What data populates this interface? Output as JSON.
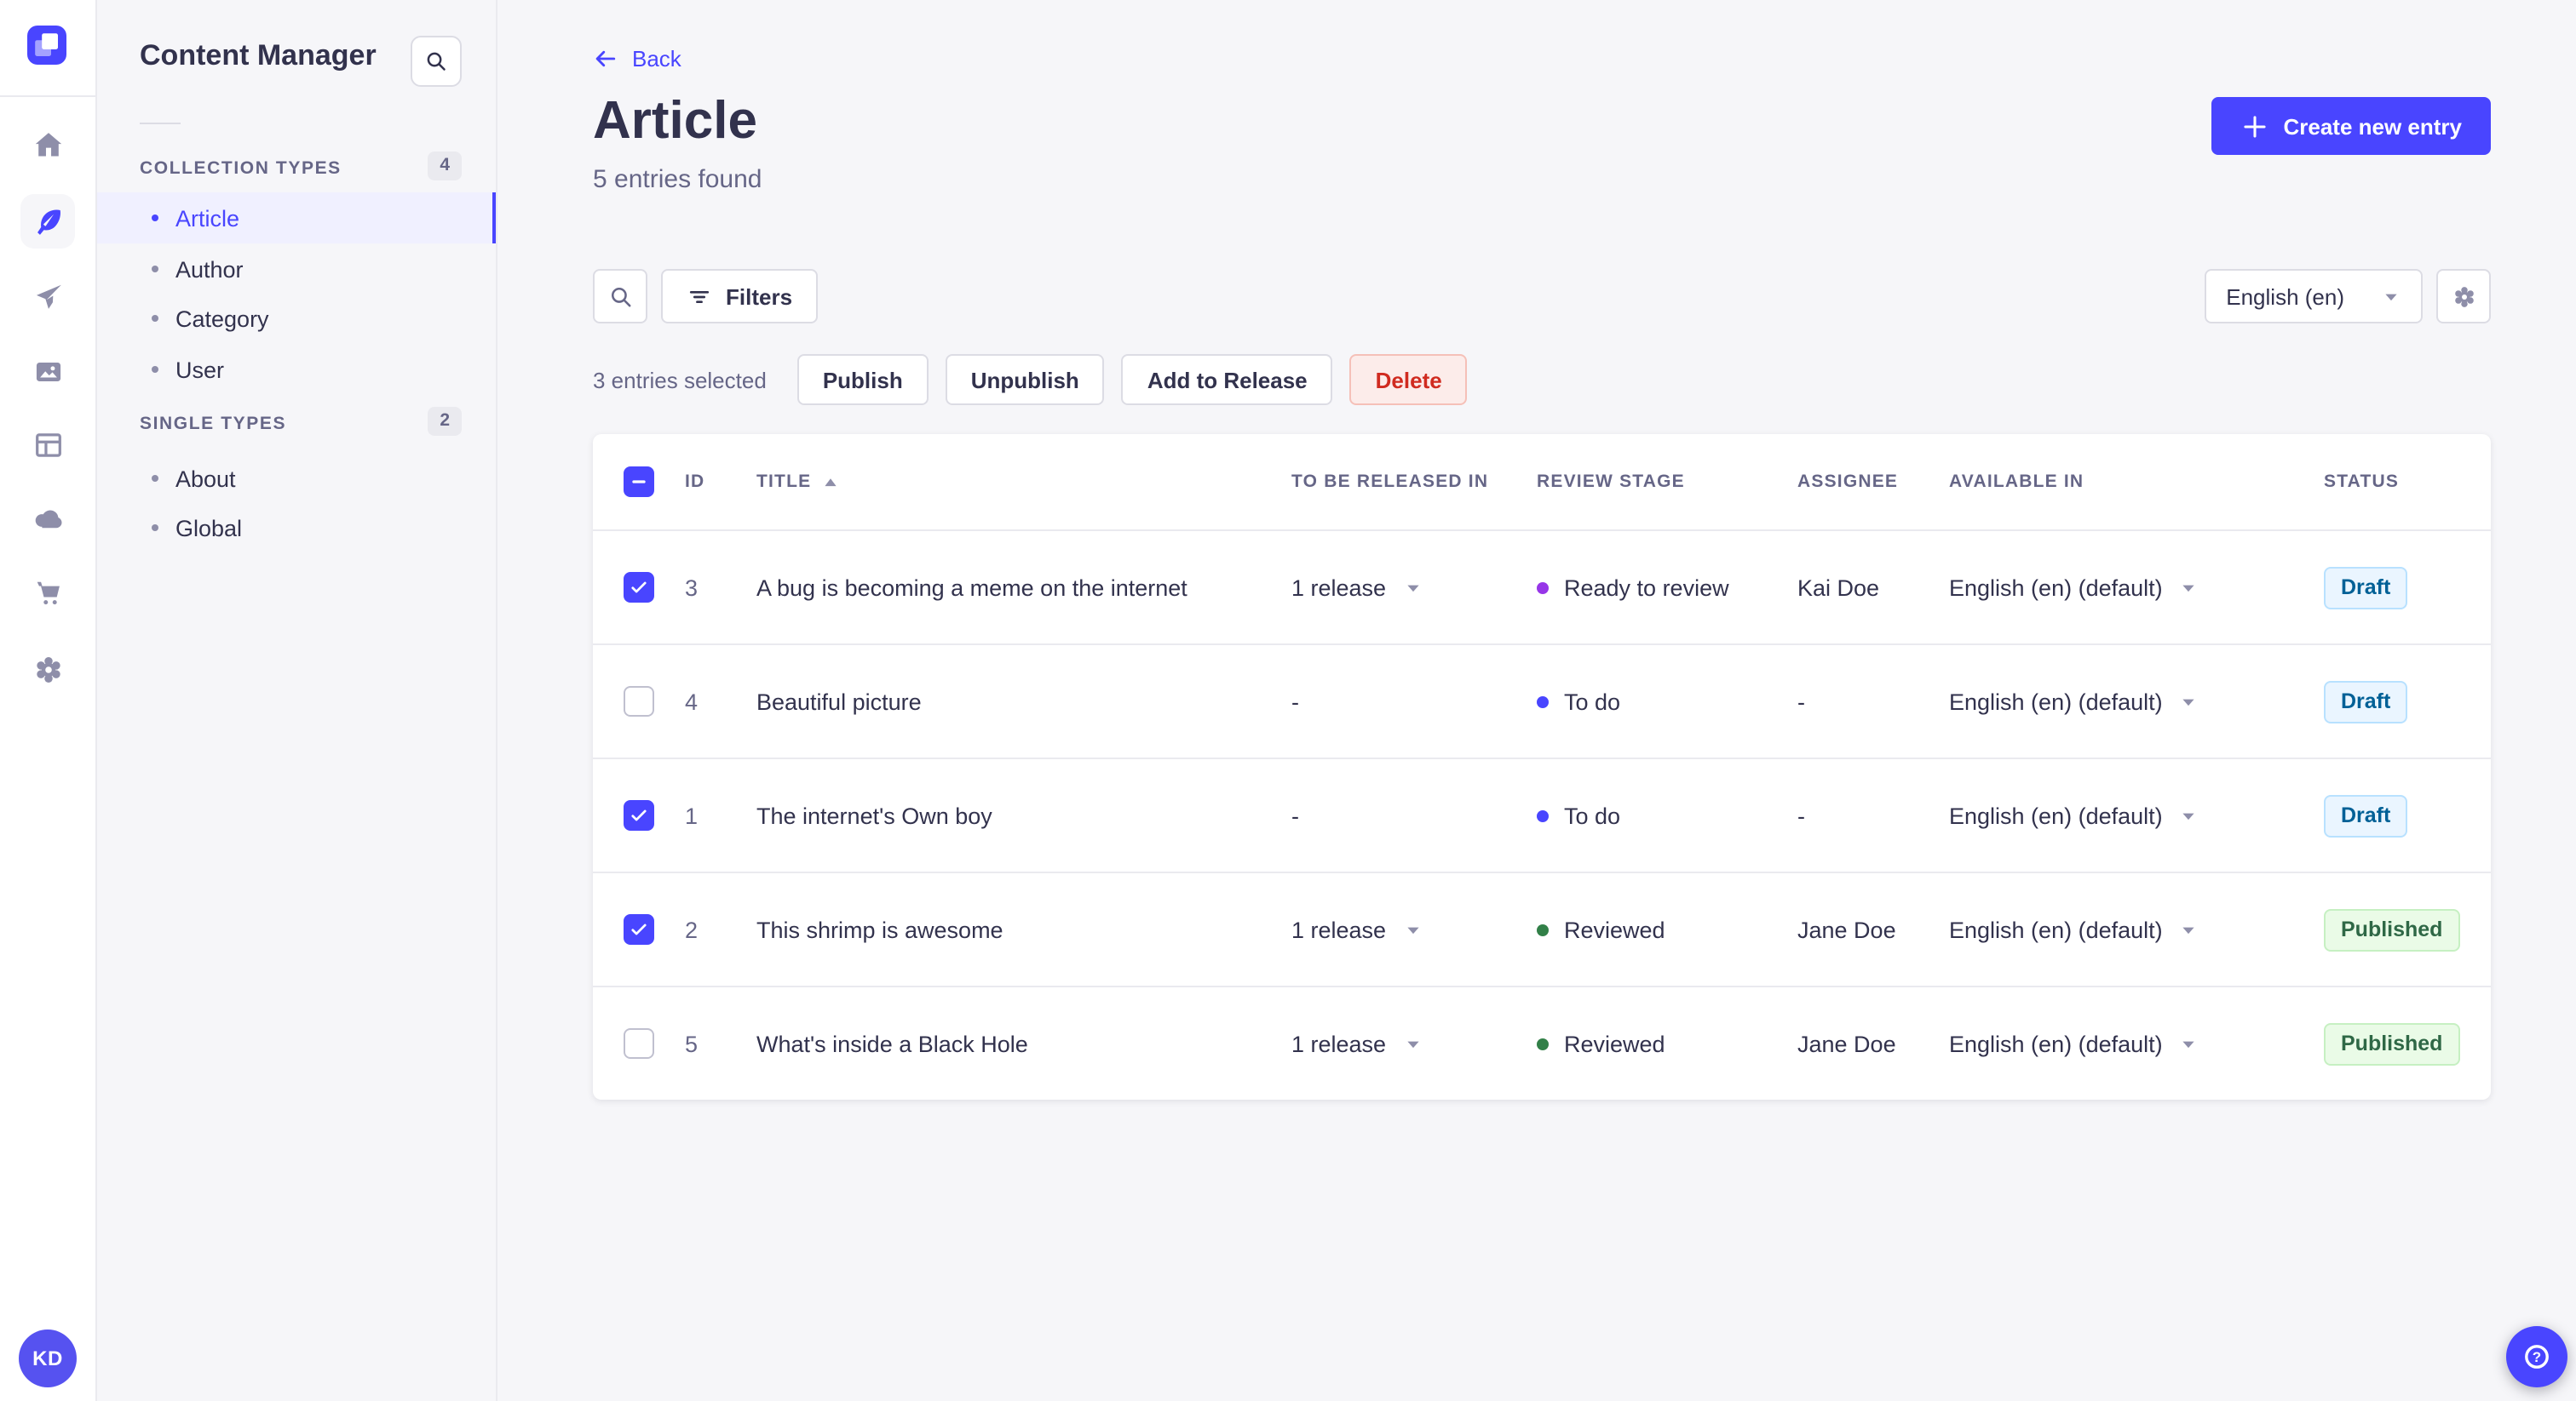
{
  "rail": {
    "logo": "strapi-logo",
    "icons": [
      "home",
      "content-manager",
      "releases",
      "media-library",
      "content-type-builder",
      "deploy",
      "marketplace",
      "settings"
    ],
    "avatar_initials": "KD"
  },
  "sidebar": {
    "title": "Content Manager",
    "sections": [
      {
        "label": "COLLECTION TYPES",
        "count": "4",
        "items": [
          {
            "label": "Article",
            "active": true
          },
          {
            "label": "Author",
            "active": false
          },
          {
            "label": "Category",
            "active": false
          },
          {
            "label": "User",
            "active": false
          }
        ]
      },
      {
        "label": "SINGLE TYPES",
        "count": "2",
        "items": [
          {
            "label": "About",
            "active": false
          },
          {
            "label": "Global",
            "active": false
          }
        ]
      }
    ]
  },
  "header": {
    "back_label": "Back",
    "title": "Article",
    "subtitle": "5 entries found",
    "create_label": "Create new entry"
  },
  "toolbar": {
    "filters_label": "Filters",
    "locale_selected": "English (en)"
  },
  "selection": {
    "count_label": "3 entries selected",
    "publish_label": "Publish",
    "unpublish_label": "Unpublish",
    "add_to_release_label": "Add to Release",
    "delete_label": "Delete"
  },
  "table": {
    "select_all_state": "indeterminate",
    "sort_column": "TITLE",
    "sort_direction": "asc",
    "headers": {
      "id": "ID",
      "title": "TITLE",
      "release": "TO BE RELEASED IN",
      "review": "REVIEW STAGE",
      "assignee": "ASSIGNEE",
      "available": "AVAILABLE IN",
      "status": "STATUS"
    },
    "rows": [
      {
        "checked": true,
        "id": "3",
        "title": "A bug is becoming a meme on the internet",
        "release": "1 release",
        "release_caret": true,
        "stage": "Ready to review",
        "stage_color": "#9736e8",
        "assignee": "Kai Doe",
        "available": "English (en) (default)",
        "status": "Draft",
        "status_kind": "draft"
      },
      {
        "checked": false,
        "id": "4",
        "title": "Beautiful picture",
        "release": "-",
        "release_caret": false,
        "stage": "To do",
        "stage_color": "#4945ff",
        "assignee": "-",
        "available": "English (en) (default)",
        "status": "Draft",
        "status_kind": "draft"
      },
      {
        "checked": true,
        "id": "1",
        "title": "The internet's Own boy",
        "release": "-",
        "release_caret": false,
        "stage": "To do",
        "stage_color": "#4945ff",
        "assignee": "-",
        "available": "English (en) (default)",
        "status": "Draft",
        "status_kind": "draft"
      },
      {
        "checked": true,
        "id": "2",
        "title": "This shrimp is awesome",
        "release": "1 release",
        "release_caret": true,
        "stage": "Reviewed",
        "stage_color": "#328048",
        "assignee": "Jane Doe",
        "available": "English (en) (default)",
        "status": "Published",
        "status_kind": "published"
      },
      {
        "checked": false,
        "id": "5",
        "title": "What's inside a Black Hole",
        "release": "1 release",
        "release_caret": true,
        "stage": "Reviewed",
        "stage_color": "#328048",
        "assignee": "Jane Doe",
        "available": "English (en) (default)",
        "status": "Published",
        "status_kind": "published"
      }
    ]
  },
  "colors": {
    "primary": "#4945ff",
    "primary_light_bg": "#f0f0ff",
    "danger_text": "#d02b20",
    "danger_bg": "#fcecea",
    "draft_text": "#006096",
    "draft_bg": "#eaf5ff",
    "published_text": "#2f6846",
    "published_bg": "#eafbe7",
    "stage_todo": "#4945ff",
    "stage_ready_to_review": "#9736e8",
    "stage_reviewed": "#328048"
  }
}
